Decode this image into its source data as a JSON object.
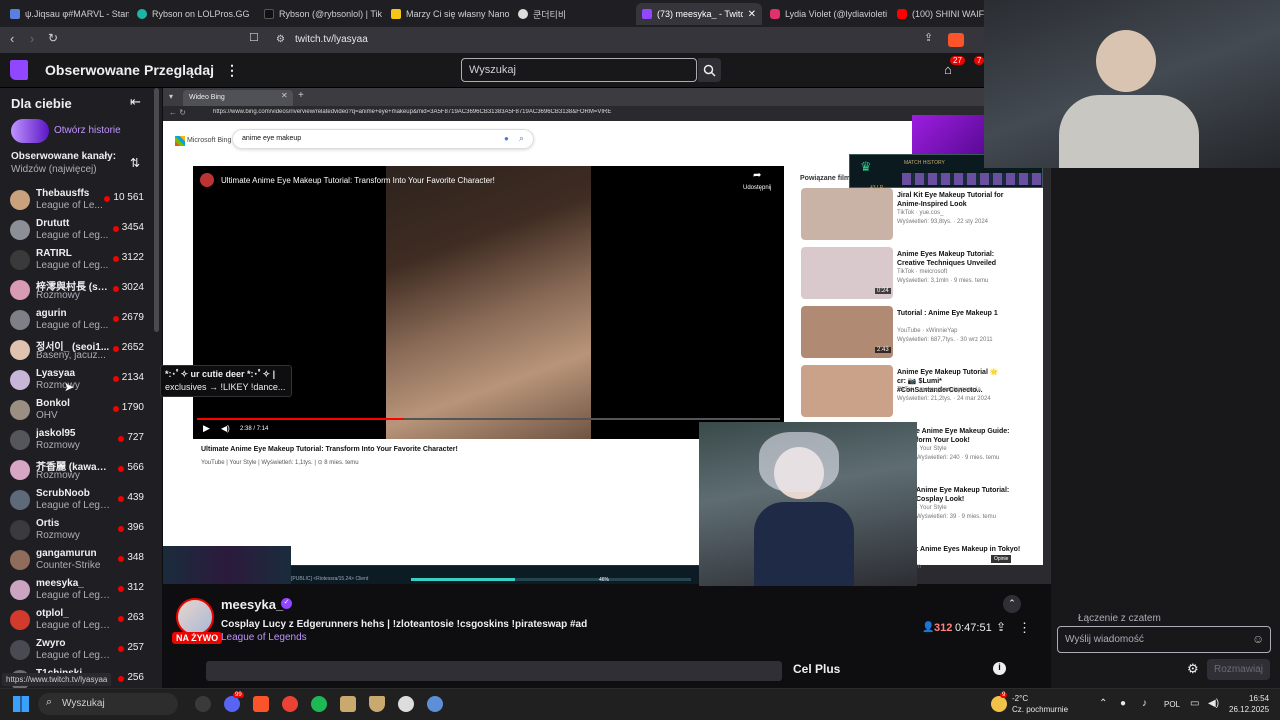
{
  "browser": {
    "tabs": [
      {
        "label": "ψ.Jiqsau φ#MARVL - Stan",
        "color": "#5b7fde"
      },
      {
        "label": "Rybson on LOLPros.GG",
        "color": "#1ab8a4"
      },
      {
        "label": "Rybson (@rybsonlol) | Tik",
        "color": "#111111"
      },
      {
        "label": "Marzy Ci się własny Nano",
        "color": "#f5c518"
      },
      {
        "label": "쿤더티비",
        "color": "#dddddd"
      },
      {
        "label": "(73) meesyka_ - Twitch",
        "color": "#9146ff"
      },
      {
        "label": "Lydia Violet (@lydiavioleti",
        "color": "#e1306c"
      },
      {
        "label": "(100) SHINI WAIFU V",
        "color": "#ff0000"
      }
    ],
    "url": "twitch.tv/lyasyaa",
    "status_url": "https://www.twitch.tv/lyasyaa"
  },
  "twitch_nav": {
    "following": "Obserwowane",
    "browse": "Przeglądaj",
    "more": "⋮",
    "search_placeholder": "Wyszukaj",
    "notif_count": "27",
    "inbox_count": "7"
  },
  "sidebar": {
    "title": "Dla ciebie",
    "history_label": "Otwórz historie",
    "followed_header": "Obserwowane kanały:",
    "sort_label": "Widzów (najwięcej)",
    "channels": [
      {
        "name": "Thebausffs",
        "game": "League of Le...",
        "viewers": "10 561",
        "color": "#c9a27d"
      },
      {
        "name": "Drututt",
        "game": "League of Leg...",
        "viewers": "3454",
        "color": "#8d8f96"
      },
      {
        "name": "RATIRL",
        "game": "League of Leg...",
        "viewers": "3122",
        "color": "#3a3a3a"
      },
      {
        "name": "梓澪與村長 (s2...",
        "game": "Rozmowy",
        "viewers": "3024",
        "color": "#d89ab5"
      },
      {
        "name": "agurin",
        "game": "League of Leg...",
        "viewers": "2679",
        "color": "#7f7f87"
      },
      {
        "name": "정서이_ (seoi1...",
        "game": "Baseny, jacuz...",
        "viewers": "2652",
        "color": "#e0c2b0"
      },
      {
        "name": "Lyasyaa",
        "game": "Rozmowy",
        "viewers": "2134",
        "color": "#c7b6d8"
      },
      {
        "name": "Bonkol",
        "game": "OHV",
        "viewers": "1790",
        "color": "#9b8f84"
      },
      {
        "name": "jaskol95",
        "game": "Rozmowy",
        "viewers": "727",
        "color": "#55565c"
      },
      {
        "name": "芥香麗 (kawa1s...",
        "game": "Rozmowy",
        "viewers": "566",
        "color": "#d7a6c4"
      },
      {
        "name": "ScrubNoob",
        "game": "League of Lege...",
        "viewers": "439",
        "color": "#5e6a7a"
      },
      {
        "name": "Ortis",
        "game": "Rozmowy",
        "viewers": "396",
        "color": "#3a3a40"
      },
      {
        "name": "gangamurun",
        "game": "Counter-Strike",
        "viewers": "348",
        "color": "#8f6c5c"
      },
      {
        "name": "meesyka_",
        "game": "League of Lege...",
        "viewers": "312",
        "color": "#caa4c0"
      },
      {
        "name": "otplol_",
        "game": "League of Lege...",
        "viewers": "263",
        "color": "#d23b2b"
      },
      {
        "name": "Zwyro",
        "game": "League of Lege...",
        "viewers": "257",
        "color": "#4a4a52"
      },
      {
        "name": "T1chinski...",
        "game": "",
        "viewers": "256",
        "color": "#6d6d75"
      }
    ]
  },
  "tooltip": {
    "line1": "*:･ﾟ✧ ur cutie deer *:･ﾟ✧ |",
    "line2": "exclusives → !LIKEY !dance..."
  },
  "stream_content": {
    "inner_tab": "Wideo Bing",
    "inner_url": "https://www.bing.com/videos/riverview/relatedvideo?q=anime+eye+makeup&mid=3A5F8719AC3696CB31383A5F8719AC3696CB3138&FORM=VIRE",
    "bing_logo": "Microsoft Bing",
    "bing_query": "anime eye makeup",
    "video_title": "Ultimate Anime Eye Makeup Tutorial: Transform Into Your Favorite Character!",
    "share_label": "Udostępnij",
    "time": "2:38 / 7:14",
    "video_meta": "YouTube  |  Your Style  |  Wyświetleń: 1,1tys.  |  ⊙ 8 mies. temu",
    "related_header": "Powiązane filmy",
    "related": [
      {
        "title": "Jiral Kit Eye Makeup Tutorial for Anime-Inspired Look",
        "meta1": "TikTok · yue.cos_",
        "meta2": "Wyświetleń: 93,8tys. · 22 sty 2024",
        "duration": "",
        "color": "#c9b3a6"
      },
      {
        "title": "Anime Eyes Makeup Tutorial: Creative Techniques Unveiled",
        "meta1": "TikTok · meicrosoft",
        "meta2": "Wyświetleń: 3,1mln · 9 mies. temu",
        "duration": "0:24",
        "color": "#d9c8cc"
      },
      {
        "title": "Tutorial : Anime Eye Makeup 1",
        "meta1": "YouTube · xWinnieYap",
        "meta2": "Wyświetleń: 687,7tys. · 30 wrz 2011",
        "duration": "2:43",
        "color": "#b08a73"
      },
      {
        "title": "Anime Eye Makeup Tutorial 🌟 cr: 📷 $Lumi* #ConSantanderConecto...",
        "meta1": "TikTok · makeupcosplaypemula",
        "meta2": "Wyświetleń: 21,2tys. · 24 mar 2024",
        "duration": "",
        "color": "#caa28a"
      },
      {
        "title": "e Anime Eye Makeup Guide: form Your Look!",
        "meta1": "· Your Style",
        "meta2": "Wyświetleń: 240 · 9 mies. temu",
        "duration": "",
        "color": "#ffffff"
      },
      {
        "title": "Anime Eye Makeup Tutorial: Cosplay Look!",
        "meta1": "· Your Style",
        "meta2": "Wyświetleń: 39 · 9 mies. temu",
        "duration": "",
        "color": "#ffffff"
      },
      {
        "title": ": Anime Eyes Makeup in Tokyo!",
        "meta1": "m",
        "meta2": "",
        "duration": "",
        "color": "#ffffff"
      }
    ],
    "feedback": "Opinie",
    "client_label": "[PUBLIC] <Riotessra/15.24> Client",
    "match_history": "MATCH HISTORY",
    "lp": "43 LP",
    "progress": "46%",
    "progress_fraction": 0.37
  },
  "stream_info": {
    "streamer": "meesyka_",
    "title": "Cosplay Lucy z Edgerunners hehs | !zloteantosie !csgoskins !pirateswap #ad",
    "game": "League of Legends",
    "live_label": "NA ŻYWO",
    "viewers": "312",
    "uptime": "0:47:51"
  },
  "below_stream": {
    "cel_plus": "Cel Plus"
  },
  "chat": {
    "connecting": "Łączenie z czatem",
    "input_placeholder": "Wyślij wiadomość",
    "send_label": "Rozmawiaj"
  },
  "taskbar": {
    "search_label": "Wyszukaj",
    "weather_temp": "-2°C",
    "weather_desc": "Cz. pochmurnie",
    "weather_badge": "9",
    "lang": "POL",
    "time": "16:54",
    "date": "26.12.2025",
    "discord_badge": "99"
  },
  "colors": {
    "twitch_purple": "#9146ff",
    "live_red": "#eb0400",
    "link_purple": "#bf94ff"
  }
}
